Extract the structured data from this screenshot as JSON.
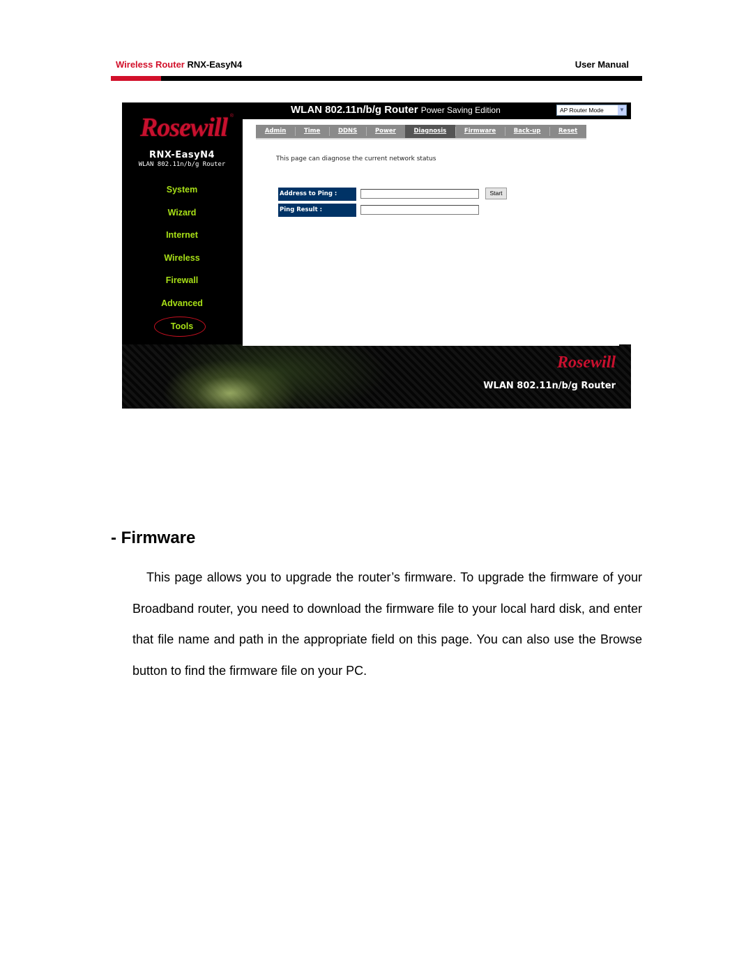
{
  "doc_header": {
    "brand": "Wireless Router",
    "model": "RNX-EasyN4",
    "right": "User Manual"
  },
  "colors": {
    "brand_red": "#d2102a",
    "nav_green": "#a8e017",
    "label_navy": "#003366",
    "tab_gray": "#8a8a8a"
  },
  "router_ui": {
    "logo": "Rosewill",
    "logo_reg": "®",
    "model_name": "RNX-EasyN4",
    "model_sub": "WLAN 802.11n/b/g Router",
    "title": "WLAN 802.11n/b/g Router",
    "title_sub": "Power Saving Edition",
    "mode_select": {
      "value": "AP Router Mode",
      "arrow_icon": "chevron-down-icon"
    },
    "nav": [
      {
        "label": "System"
      },
      {
        "label": "Wizard"
      },
      {
        "label": "Internet"
      },
      {
        "label": "Wireless"
      },
      {
        "label": "Firewall"
      },
      {
        "label": "Advanced"
      },
      {
        "label": "Tools",
        "active": true
      }
    ],
    "tabs": [
      {
        "label": "Admin"
      },
      {
        "label": "Time"
      },
      {
        "label": "DDNS"
      },
      {
        "label": "Power"
      },
      {
        "label": "Diagnosis",
        "active": true
      },
      {
        "label": "Firmware"
      },
      {
        "label": "Back-up"
      },
      {
        "label": "Reset"
      }
    ],
    "page_desc": "This page can diagnose the current network status",
    "form": {
      "address_label": "Address to Ping :",
      "address_value": "",
      "start_label": "Start",
      "result_label": "Ping Result :",
      "result_value": ""
    },
    "footer": {
      "logo": "Rosewill",
      "title": "WLAN 802.11n/b/g Router"
    }
  },
  "section": {
    "title": "- Firmware",
    "body": "This page allows you to upgrade the router’s firmware. To upgrade the firmware of your Broadband router, you need to download the firmware file to your local hard disk, and enter that file name and path in the appropriate field on this page. You can also use the Browse button to find the firmware file on your PC."
  }
}
